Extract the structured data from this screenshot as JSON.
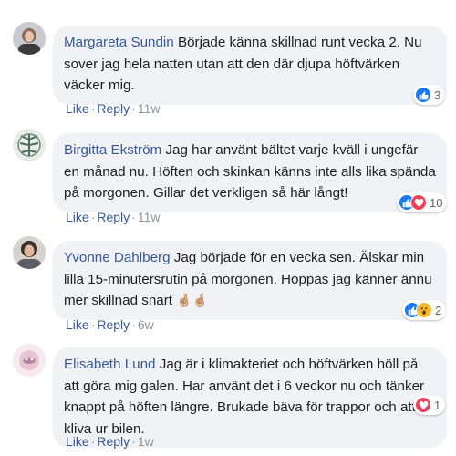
{
  "comments": [
    {
      "author": "Margareta Sundin",
      "text": "Började känna skillnad runt vecka 2. Nu sover jag hela natten utan att den där djupa höftvärken väcker mig.",
      "like_label": "Like",
      "reply_label": "Reply",
      "time": "11w",
      "reactions": [
        "like-icon"
      ],
      "reaction_count": "3"
    },
    {
      "author": "Birgitta Ekström",
      "text": "Jag har använt bältet varje kväll i ungefär en månad nu. Höften och skinkan känns inte alls lika spända på morgonen. Gillar det verkligen så här långt!",
      "like_label": "Like",
      "reply_label": "Reply",
      "time": "11w",
      "reactions": [
        "like-icon",
        "love-icon"
      ],
      "reaction_count": "10"
    },
    {
      "author": "Yvonne Dahlberg",
      "text": "Jag började för en vecka sen. Älskar min lilla 15-minutersrutin på morgonen. Hoppas jag känner ännu mer skillnad snart",
      "emoji": "🤞🏼🤞🏼",
      "like_label": "Like",
      "reply_label": "Reply",
      "time": "6w",
      "reactions": [
        "like-icon",
        "wow-icon"
      ],
      "reaction_count": "2"
    },
    {
      "author": "Elisabeth Lund",
      "text": "Jag är i klimakteriet och höftvärken höll på att göra mig galen. Har använt det i 6 veckor nu och tänker knappt på höften längre. Brukade bäva för trappor och att kliva ur bilen.",
      "like_label": "Like",
      "reply_label": "Reply",
      "time": "1w",
      "reactions": [
        "love-icon"
      ],
      "reaction_count": "1"
    }
  ],
  "separator": "·",
  "colors": {
    "author": "#385898",
    "bubble": "#f0f2f5",
    "meta": "#90949c",
    "like": "#1877f2",
    "love": "#f33e58",
    "wow": "#f7b928"
  }
}
